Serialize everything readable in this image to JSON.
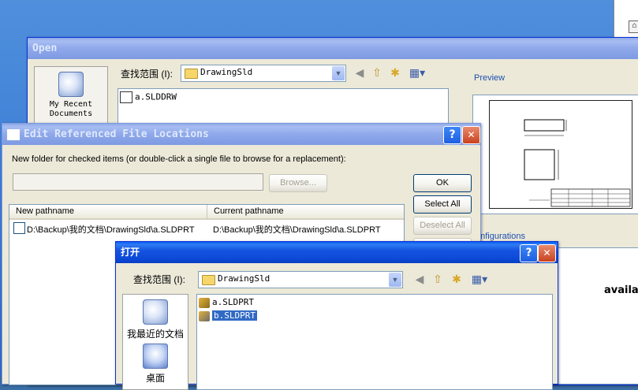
{
  "open_dialog": {
    "title": "Open",
    "look_in_label": "查找范围 (I):",
    "look_in_value": "DrawingSld",
    "places": [
      {
        "label": "My Recent Documents"
      }
    ],
    "files": [
      "a.SLDDRW"
    ],
    "preview_label": "Preview",
    "configurations_label": "onfigurations",
    "side_text": "availab"
  },
  "edit_dialog": {
    "title": "Edit Referenced File Locations",
    "help_btn": "?",
    "close_btn": "✕",
    "instruction": "New folder for checked items (or double-click a single file to browse for a replacement):",
    "folder_value": "",
    "browse_label": "Browse...",
    "ok_label": "OK",
    "select_all_label": "Select All",
    "deselect_all_label": "Deselect All",
    "columns": [
      "New pathname",
      "Current pathname"
    ],
    "rows": [
      {
        "new": "D:\\Backup\\我的文档\\DrawingSld\\a.SLDPRT",
        "current": "D:\\Backup\\我的文档\\DrawingSld\\a.SLDPRT"
      }
    ]
  },
  "cn_dialog": {
    "title": "打开",
    "help_btn": "?",
    "close_btn": "✕",
    "look_in_label": "查找范围 (I):",
    "look_in_value": "DrawingSld",
    "places": [
      {
        "label": "我最近的文档"
      },
      {
        "label": "桌面"
      }
    ],
    "files": [
      {
        "name": "a.SLDPRT",
        "selected": false
      },
      {
        "name": "b.SLDPRT",
        "selected": true
      }
    ]
  },
  "colors": {
    "title_active": "#0a5cf5",
    "title_inactive": "#8fa8e6",
    "selection": "#316ac5"
  }
}
